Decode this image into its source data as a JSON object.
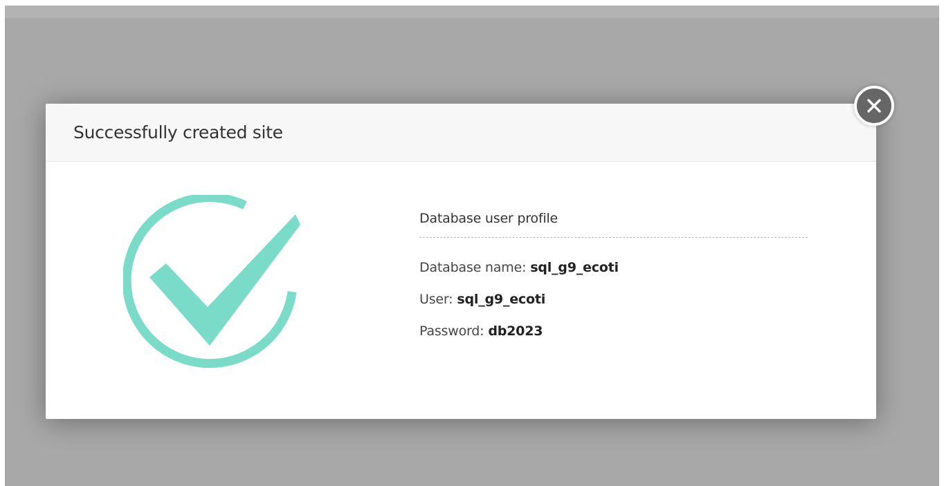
{
  "dialog": {
    "title": "Successfully created site",
    "close_icon": "close-icon",
    "success_icon": "check-circle-icon",
    "accent_color": "#7adbc9"
  },
  "database_profile": {
    "heading": "Database user profile",
    "rows": [
      {
        "label": "Database name:",
        "value": "sql_g9_ecoti"
      },
      {
        "label": "User:",
        "value": "sql_g9_ecoti"
      },
      {
        "label": "Password:",
        "value": "db2023"
      }
    ]
  }
}
